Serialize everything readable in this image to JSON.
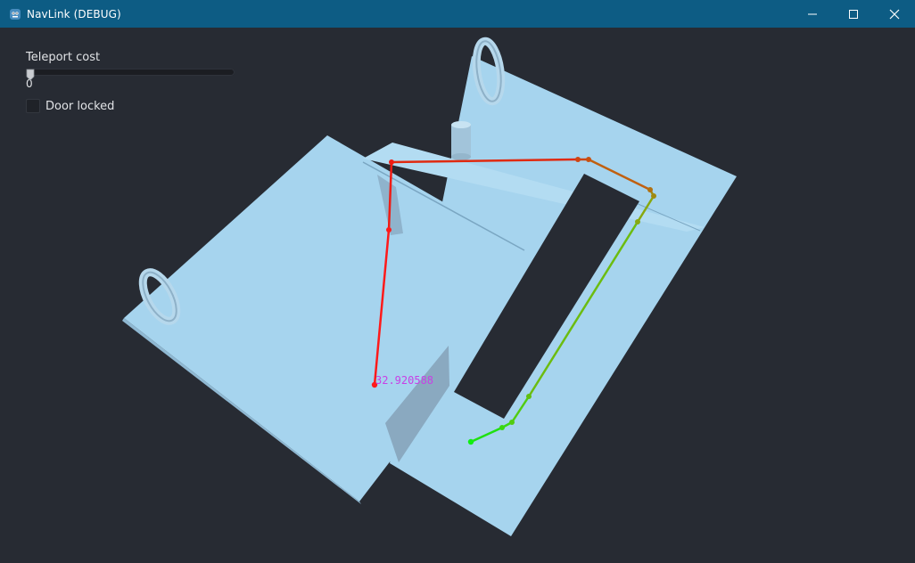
{
  "window": {
    "title": "NavLink (DEBUG)",
    "app_icon": "godot-icon",
    "controls": [
      "minimize-icon",
      "maximize-icon",
      "close-icon"
    ]
  },
  "ui": {
    "slider_label": "Teleport cost",
    "slider_value": "0",
    "checkbox_label": "Door locked",
    "checkbox_checked": false
  },
  "scene": {
    "path_cost_label": "32.920588",
    "colors": {
      "background": "#272b33",
      "navmesh": "#a6d4ee",
      "path_start": "#00e000",
      "path_end": "#ff1a1a",
      "cost_text": "#c840e6"
    }
  }
}
